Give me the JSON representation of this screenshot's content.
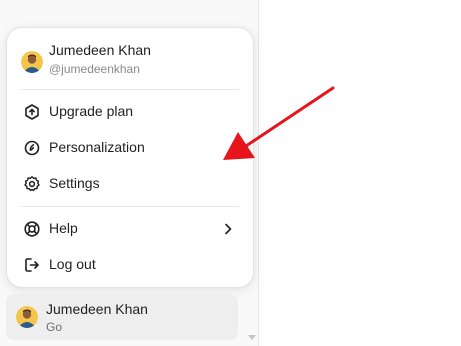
{
  "profile": {
    "name": "Jumedeen Khan",
    "handle": "@jumedeenkhan"
  },
  "menu": {
    "items": [
      {
        "label": "Upgrade plan",
        "icon": "upgrade-icon"
      },
      {
        "label": "Personalization",
        "icon": "personalization-icon"
      },
      {
        "label": "Settings",
        "icon": "gear-icon"
      },
      {
        "label": "Help",
        "icon": "lifebuoy-icon"
      },
      {
        "label": "Log out",
        "icon": "logout-icon"
      }
    ]
  },
  "footer": {
    "name": "Jumedeen Khan",
    "plan": "Go"
  },
  "colors": {
    "annotation_arrow": "#e8141c",
    "sidebar_bg": "#f9f9f9",
    "footer_bg": "#eeeeee"
  }
}
